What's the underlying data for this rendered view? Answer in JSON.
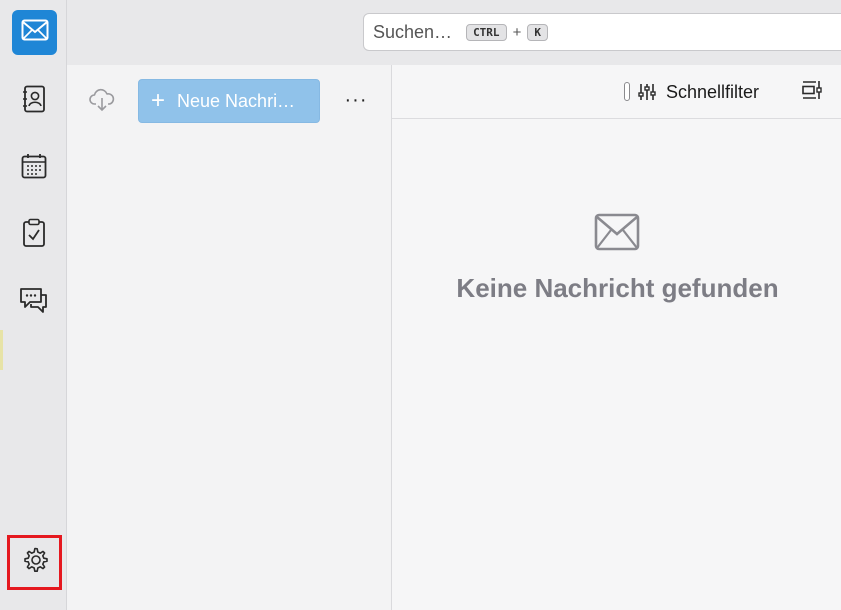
{
  "sidebar": {
    "items": [
      {
        "name": "mail",
        "icon": "mail-icon",
        "active": true
      },
      {
        "name": "address-book",
        "icon": "address-book-icon"
      },
      {
        "name": "calendar",
        "icon": "calendar-icon"
      },
      {
        "name": "tasks",
        "icon": "tasks-icon"
      },
      {
        "name": "chat",
        "icon": "chat-icon"
      }
    ],
    "settings_icon": "gear-icon",
    "highlight_color": "#e5181f"
  },
  "search": {
    "placeholder": "Suchen…",
    "shortcut_key1": "CTRL",
    "shortcut_plus": "+",
    "shortcut_key2": "K"
  },
  "folder_pane": {
    "new_message_label": "Neue Nachri…",
    "new_message_plus": "+",
    "more_label": "···"
  },
  "message_pane": {
    "quickfilter_label": "Schnellfilter",
    "empty_message": "Keine Nachricht gefunden"
  },
  "colors": {
    "accent": "#1f86d6",
    "new_message_button": "#90c2ea"
  }
}
